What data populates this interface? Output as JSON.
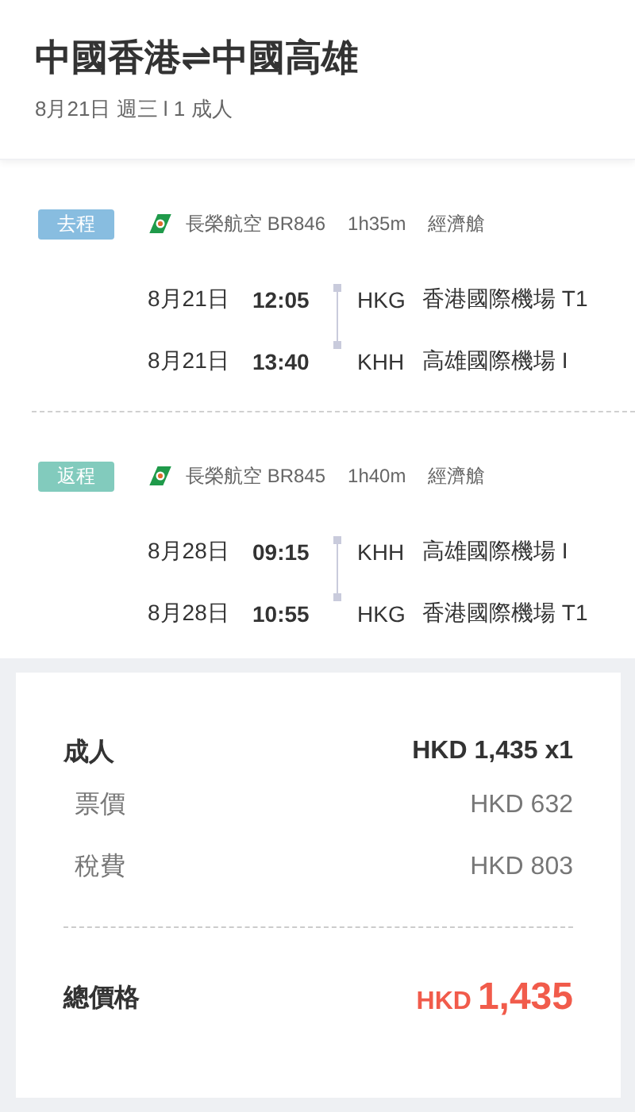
{
  "header": {
    "title": "中國香港⇌中國高雄",
    "subtitle": "8月21日 週三 l 1 成人"
  },
  "legs": [
    {
      "badge": "去程",
      "color": "#88bde0",
      "airline": "長榮航空 BR846",
      "duration": "1h35m",
      "cabin": "經濟艙",
      "stops": [
        {
          "date": "8月21日",
          "time": "12:05",
          "code": "HKG",
          "airport": "香港國際機場 T1"
        },
        {
          "date": "8月21日",
          "time": "13:40",
          "code": "KHH",
          "airport": "高雄國際機場 I"
        }
      ]
    },
    {
      "badge": "返程",
      "color": "#82cbbd",
      "airline": "長榮航空 BR845",
      "duration": "1h40m",
      "cabin": "經濟艙",
      "stops": [
        {
          "date": "8月28日",
          "time": "09:15",
          "code": "KHH",
          "airport": "高雄國際機場 I"
        },
        {
          "date": "8月28日",
          "time": "10:55",
          "code": "HKG",
          "airport": "香港國際機場 T1"
        }
      ]
    }
  ],
  "price": {
    "passenger": {
      "label": "成人",
      "amount": "HKD 1,435 x1"
    },
    "items": [
      {
        "label": "票價",
        "amount": "HKD 632"
      },
      {
        "label": "稅費",
        "amount": "HKD 803"
      }
    ],
    "total": {
      "label": "總價格",
      "currency": "HKD",
      "amount": "1,435"
    }
  }
}
